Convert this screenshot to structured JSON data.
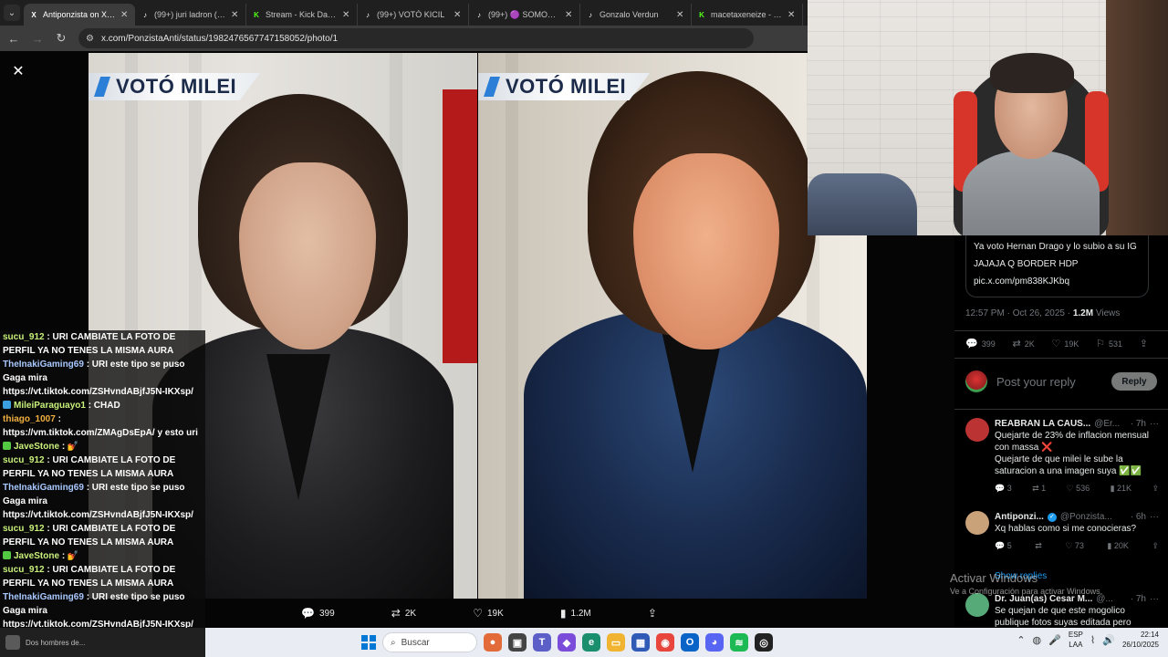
{
  "browser": {
    "tabs": [
      {
        "label": "Antiponzista on X: \"E",
        "favicon": "x-icon",
        "active": true
      },
      {
        "label": "(99+) juri ladron (@cl",
        "favicon": "tiktok-icon"
      },
      {
        "label": "Stream - Kick Dashbo",
        "favicon": "kick-icon"
      },
      {
        "label": "(99+) VOTÓ KICIL",
        "favicon": "tiktok-icon"
      },
      {
        "label": "(99+) 🟣 SOMOS R",
        "favicon": "tiktok-icon"
      },
      {
        "label": "Gonzalo Verdun",
        "favicon": "tiktok-icon"
      },
      {
        "label": "macetaxeneize - Wat",
        "favicon": "kick-icon"
      }
    ],
    "url": "x.com/PonzistaAnti/status/1982476567747158052/photo/1"
  },
  "photo": {
    "banner_left": "VOTÓ MILEI",
    "banner_right": "VOTÓ MILEI"
  },
  "post_actions": {
    "replies": "399",
    "reposts": "2K",
    "likes": "19K",
    "views": "1.2M"
  },
  "chat": [
    {
      "user": "sucu_912",
      "color": "#c8f07a",
      "text": ": URI CAMBIATE LA FOTO DE PERFIL YA NO TENES LA MISMA AURA"
    },
    {
      "user": "TheInakiGaming69",
      "color": "#a8c8ff",
      "text": ": URI este tipo se puso Gaga mira https://vt.tiktok.com/ZSHvndABjfJ5N-IKXsp/"
    },
    {
      "user": "MileiParaguayo1",
      "color": "#c8f07a",
      "badge": "#3aa0e0",
      "text": ": CHAD"
    },
    {
      "user": "thiago_1007",
      "color": "#f0b040",
      "text": ": https://vm.tiktok.com/ZMAgDsEpA/ y esto uri"
    },
    {
      "user": "JaveStone",
      "color": "#c8f07a",
      "badge": "#53c843",
      "text": ": 💅"
    },
    {
      "user": "sucu_912",
      "color": "#c8f07a",
      "text": ": URI CAMBIATE LA FOTO DE PERFIL YA NO TENES LA MISMA AURA"
    },
    {
      "user": "TheInakiGaming69",
      "color": "#a8c8ff",
      "text": ": URI este tipo se puso Gaga mira https://vt.tiktok.com/ZSHvndABjfJ5N-IKXsp/"
    },
    {
      "user": "sucu_912",
      "color": "#c8f07a",
      "text": ": URI CAMBIATE LA FOTO DE PERFIL YA NO TENES LA MISMA AURA"
    },
    {
      "user": "JaveStone",
      "color": "#c8f07a",
      "badge": "#53c843",
      "text": ": 💅"
    },
    {
      "user": "sucu_912",
      "color": "#c8f07a",
      "text": ": URI CAMBIATE LA FOTO DE PERFIL YA NO TENES LA MISMA AURA"
    },
    {
      "user": "TheInakiGaming69",
      "color": "#a8c8ff",
      "text": ": URI este tipo se puso Gaga mira https://vt.tiktok.com/ZSHvndABjfJ5N-IKXsp/"
    }
  ],
  "post": {
    "quote_line1": "Ya voto Hernan Drago y lo subio a su IG",
    "quote_line2": "JAJAJA Q BORDER HDP",
    "quote_link": "pic.x.com/pm838KJKbq",
    "timestamp": "12:57 PM · Oct 26, 2025 ·",
    "views_count": "1.2M",
    "views_label": "Views",
    "stats": {
      "replies": "399",
      "reposts": "2K",
      "likes": "19K",
      "bookmarks": "531"
    }
  },
  "compose": {
    "placeholder": "Post your reply",
    "button": "Reply"
  },
  "replies": [
    {
      "name": "REABRAN LA CAUS...",
      "handle": "@Er...",
      "time": "· 7h",
      "body": "Quejarte de 23% de inflacion mensual con massa ❌\nQuejarte de que milei le sube la saturacion a una imagen suya ✅✅",
      "stats": {
        "replies": "3",
        "reposts": "1",
        "likes": "536",
        "views": "21K"
      },
      "avatar_color": "#b33"
    },
    {
      "name": "Antiponzi...",
      "handle": "@Ponzista...",
      "time": "· 6h",
      "verified": true,
      "body": "Xq hablas como si me conocieras?",
      "stats": {
        "replies": "5",
        "reposts": "",
        "likes": "73",
        "views": "20K"
      },
      "avatar_color": "#c9a27a"
    },
    {
      "name": "Dr. Juan(as) Cesar M...",
      "handle": "@...",
      "time": "· 7h",
      "body": "Se quejan de que este mogolico publique fotos suyas editada pero",
      "stats": {},
      "avatar_color": "#5a7"
    }
  ],
  "show_replies": "Show replies",
  "windows_activation": {
    "title": "Activar Windows",
    "subtitle": "Ve a Configuración para activar Windows."
  },
  "taskbar": {
    "preview_label": "Dos hombres de...",
    "search_label": "Buscar",
    "lang_line1": "ESP",
    "lang_line2": "LAA",
    "time": "22:14",
    "date": "26/10/2025"
  }
}
